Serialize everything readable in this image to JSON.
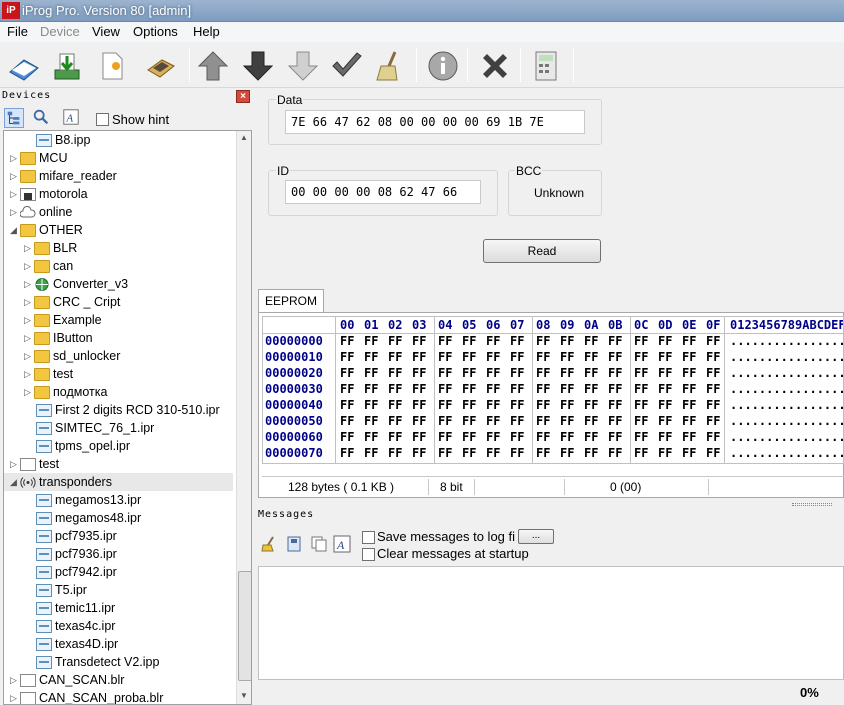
{
  "window": {
    "title": "iProg Pro. Version 80 [admin]",
    "logo": "iP"
  },
  "menu": [
    "File",
    "Device",
    "View",
    "Options",
    "Help"
  ],
  "toolbar": [
    "open-book-icon",
    "save-download-icon",
    "new-file-icon",
    "chip-icon",
    "arrow-up-icon",
    "arrow-down-icon",
    "arrow-down-outline-icon",
    "checkmark-icon",
    "broom-icon",
    "info-icon",
    "close-x-icon",
    "calculator-icon"
  ],
  "devices": {
    "title": "Devices",
    "show_hint": "Show hint",
    "tree": [
      {
        "label": "B8.ipp",
        "type": "file",
        "level": 2
      },
      {
        "label": "MCU",
        "type": "folder",
        "level": 0
      },
      {
        "label": "mifare_reader",
        "type": "folder",
        "level": 0
      },
      {
        "label": "motorola",
        "type": "chip",
        "level": 0
      },
      {
        "label": "online",
        "type": "cloud",
        "level": 0
      },
      {
        "label": "OTHER",
        "type": "folder",
        "level": 0,
        "expanded": true
      },
      {
        "label": "BLR",
        "type": "folder",
        "level": 1
      },
      {
        "label": "can",
        "type": "folder",
        "level": 1
      },
      {
        "label": "Converter_v3",
        "type": "globe",
        "level": 1
      },
      {
        "label": "CRC _ Cript",
        "type": "folder",
        "level": 1
      },
      {
        "label": "Example",
        "type": "folder",
        "level": 1
      },
      {
        "label": "IButton",
        "type": "folder",
        "level": 1
      },
      {
        "label": "sd_unlocker",
        "type": "folder",
        "level": 1
      },
      {
        "label": "test",
        "type": "folder",
        "level": 1
      },
      {
        "label": "подмотка",
        "type": "folder",
        "level": 1
      },
      {
        "label": "First 2 digits RCD 310-510.ipr",
        "type": "file",
        "level": 2
      },
      {
        "label": "SIMTEC_76_1.ipr",
        "type": "file",
        "level": 2
      },
      {
        "label": "tpms_opel.ipr",
        "type": "file",
        "level": 2
      },
      {
        "label": "test",
        "type": "plain",
        "level": 0
      },
      {
        "label": "transponders",
        "type": "radio",
        "level": 0,
        "expanded": true,
        "selected": true
      },
      {
        "label": "megamos13.ipr",
        "type": "file",
        "level": 2
      },
      {
        "label": "megamos48.ipr",
        "type": "file",
        "level": 2
      },
      {
        "label": "pcf7935.ipr",
        "type": "file",
        "level": 2
      },
      {
        "label": "pcf7936.ipr",
        "type": "file",
        "level": 2
      },
      {
        "label": "pcf7942.ipr",
        "type": "file",
        "level": 2
      },
      {
        "label": "T5.ipr",
        "type": "file",
        "level": 2
      },
      {
        "label": "temic11.ipr",
        "type": "file",
        "level": 2
      },
      {
        "label": "texas4c.ipr",
        "type": "file",
        "level": 2
      },
      {
        "label": "texas4D.ipr",
        "type": "file",
        "level": 2
      },
      {
        "label": "Transdetect V2.ipp",
        "type": "file",
        "level": 2
      },
      {
        "label": "CAN_SCAN.blr",
        "type": "plain",
        "level": 0
      },
      {
        "label": "CAN_SCAN_proba.blr",
        "type": "plain",
        "level": 0
      }
    ]
  },
  "data_box": {
    "label": "Data",
    "value": "7E 66 47 62 08 00 00 00 00 69 1B 7E"
  },
  "id_box": {
    "label": "ID",
    "value": "00 00 00 00 08 62 47 66"
  },
  "bcc_box": {
    "label": "BCC",
    "value": "Unknown"
  },
  "read_button": "Read",
  "eeprom": {
    "tab": "EEPROM",
    "col_headers": [
      "00",
      "01",
      "02",
      "03",
      "04",
      "05",
      "06",
      "07",
      "08",
      "09",
      "0A",
      "0B",
      "0C",
      "0D",
      "0E",
      "0F"
    ],
    "ascii_header": "0123456789ABCDEF",
    "rows": [
      {
        "addr": "00000000",
        "bytes": [
          "FF",
          "FF",
          "FF",
          "FF",
          "FF",
          "FF",
          "FF",
          "FF",
          "FF",
          "FF",
          "FF",
          "FF",
          "FF",
          "FF",
          "FF",
          "FF"
        ],
        "ascii": "................"
      },
      {
        "addr": "00000010",
        "bytes": [
          "FF",
          "FF",
          "FF",
          "FF",
          "FF",
          "FF",
          "FF",
          "FF",
          "FF",
          "FF",
          "FF",
          "FF",
          "FF",
          "FF",
          "FF",
          "FF"
        ],
        "ascii": "................"
      },
      {
        "addr": "00000020",
        "bytes": [
          "FF",
          "FF",
          "FF",
          "FF",
          "FF",
          "FF",
          "FF",
          "FF",
          "FF",
          "FF",
          "FF",
          "FF",
          "FF",
          "FF",
          "FF",
          "FF"
        ],
        "ascii": "................"
      },
      {
        "addr": "00000030",
        "bytes": [
          "FF",
          "FF",
          "FF",
          "FF",
          "FF",
          "FF",
          "FF",
          "FF",
          "FF",
          "FF",
          "FF",
          "FF",
          "FF",
          "FF",
          "FF",
          "FF"
        ],
        "ascii": "................"
      },
      {
        "addr": "00000040",
        "bytes": [
          "FF",
          "FF",
          "FF",
          "FF",
          "FF",
          "FF",
          "FF",
          "FF",
          "FF",
          "FF",
          "FF",
          "FF",
          "FF",
          "FF",
          "FF",
          "FF"
        ],
        "ascii": "................"
      },
      {
        "addr": "00000050",
        "bytes": [
          "FF",
          "FF",
          "FF",
          "FF",
          "FF",
          "FF",
          "FF",
          "FF",
          "FF",
          "FF",
          "FF",
          "FF",
          "FF",
          "FF",
          "FF",
          "FF"
        ],
        "ascii": "................"
      },
      {
        "addr": "00000060",
        "bytes": [
          "FF",
          "FF",
          "FF",
          "FF",
          "FF",
          "FF",
          "FF",
          "FF",
          "FF",
          "FF",
          "FF",
          "FF",
          "FF",
          "FF",
          "FF",
          "FF"
        ],
        "ascii": "................"
      },
      {
        "addr": "00000070",
        "bytes": [
          "FF",
          "FF",
          "FF",
          "FF",
          "FF",
          "FF",
          "FF",
          "FF",
          "FF",
          "FF",
          "FF",
          "FF",
          "FF",
          "FF",
          "FF",
          "FF"
        ],
        "ascii": "................"
      }
    ],
    "status": {
      "size": "128 bytes ( 0.1 KB )",
      "bits": "8 bit",
      "pos": "0 (00)"
    }
  },
  "messages": {
    "title": "Messages",
    "save_log": "Save messages to log fi",
    "browse": "...",
    "clear_startup": "Clear messages at startup",
    "progress": "0%"
  }
}
